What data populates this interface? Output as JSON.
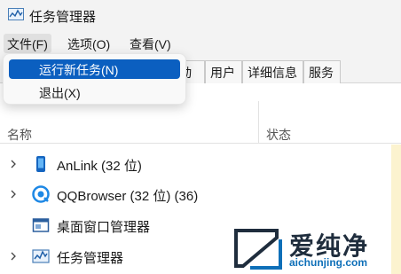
{
  "window": {
    "title": "任务管理器"
  },
  "menubar": {
    "file": "文件(F)",
    "options": "选项(O)",
    "view": "查看(V)"
  },
  "file_menu": {
    "items": [
      {
        "label": "运行新任务(N)",
        "highlighted": true
      },
      {
        "label": "退出(X)"
      }
    ]
  },
  "tabs": [
    {
      "label": "动"
    },
    {
      "label": "用户"
    },
    {
      "label": "详细信息"
    },
    {
      "label": "服务"
    }
  ],
  "columns": {
    "name": "名称",
    "status": "状态"
  },
  "processes": [
    {
      "label": "AnLink (32 位)",
      "expandable": true,
      "icon": "anlink-icon"
    },
    {
      "label": "QQBrowser (32 位) (36)",
      "expandable": true,
      "icon": "qqbrowser-icon"
    },
    {
      "label": "桌面窗口管理器",
      "expandable": false,
      "icon": "dwm-icon"
    },
    {
      "label": "任务管理器",
      "expandable": true,
      "icon": "task-manager-icon"
    }
  ],
  "watermark": {
    "brand": "爱纯净",
    "url": "aichunjing.com"
  },
  "colors": {
    "accent": "#0b5fc0",
    "status_highlight": "#fcf3cf",
    "chrome": "#f3f3f3"
  }
}
